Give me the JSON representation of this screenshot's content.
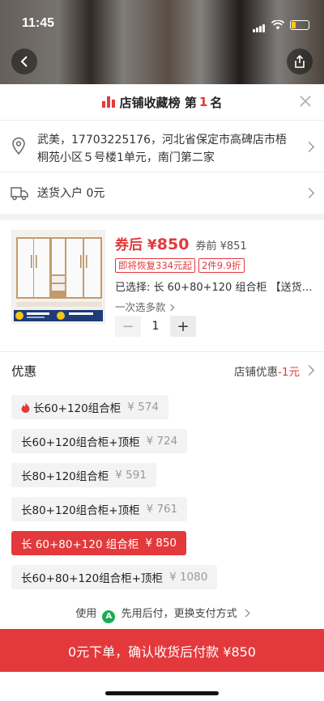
{
  "status": {
    "time": "11:45"
  },
  "rank": {
    "prefix": "店铺收藏榜 第",
    "number": "1",
    "suffix": "名"
  },
  "address": {
    "text": "武美，17703225176，河北省保定市高碑店市梧桐苑小区５号楼1单元，南门第二家"
  },
  "shipping": {
    "text": "送货入户 0元"
  },
  "product": {
    "price_prefix": "券后",
    "price_symbol": "¥",
    "price_value": "850",
    "price_before": "券前 ¥851",
    "tags": [
      "即将恢复334元起",
      "2件9.9折"
    ],
    "selected": "已选择: 长 60+80+120 组合柜 【送货…",
    "multi": "一次选多款"
  },
  "quantity": {
    "value": "1",
    "minus": "−",
    "plus": "+"
  },
  "coupon": {
    "title": "优惠",
    "right_label": "店铺优惠",
    "right_value": "-1元"
  },
  "options": [
    {
      "label": "长60+120组合柜",
      "price": "¥ 574",
      "hot": true,
      "selected": false
    },
    {
      "label": "长60+120组合柜+顶柜",
      "price": "¥ 724",
      "hot": false,
      "selected": false
    },
    {
      "label": "长80+120组合柜",
      "price": "¥ 591",
      "hot": false,
      "selected": false
    },
    {
      "label": "长80+120组合柜+顶柜",
      "price": "¥ 761",
      "hot": false,
      "selected": false
    },
    {
      "label": "长 60+80+120 组合柜",
      "price": "¥ 850",
      "hot": false,
      "selected": true
    },
    {
      "label": "长60+80+120组合柜+顶柜",
      "price": "¥ 1080",
      "hot": false,
      "selected": false
    }
  ],
  "payment": {
    "prefix": "使用",
    "badge": "A",
    "label": "先用后付，更换支付方式"
  },
  "cta": {
    "label": "0元下单，确认收货后付款 ¥850"
  },
  "colors": {
    "accent": "#e4393c",
    "pay_green": "#1aad52"
  }
}
